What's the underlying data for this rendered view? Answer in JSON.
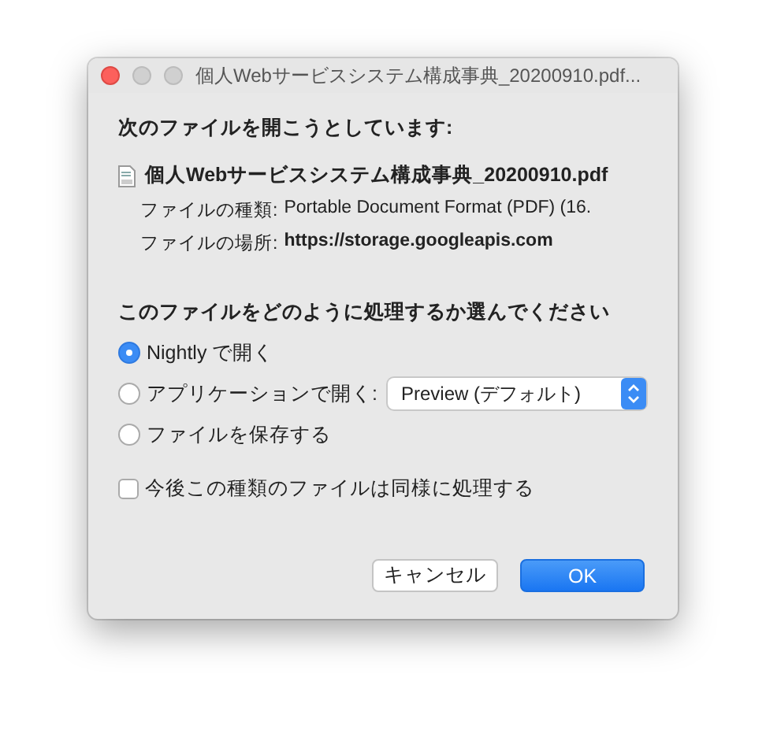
{
  "window": {
    "title": "個人Webサービスシステム構成事典_20200910.pdf..."
  },
  "heading": "次のファイルを開こうとしています:",
  "file": {
    "name": "個人Webサービスシステム構成事典_20200910.pdf",
    "details": [
      {
        "label": "ファイルの種類:",
        "value": "Portable Document Format (PDF) (16.",
        "bold": false
      },
      {
        "label": "ファイルの場所:",
        "value": "https://storage.googleapis.com",
        "bold": true
      }
    ]
  },
  "question": "このファイルをどのように処理するか選んでください",
  "options": [
    {
      "kind": "plain",
      "label": "Nightly で開く",
      "selected": true
    },
    {
      "kind": "app",
      "label": "アプリケーションで開く:",
      "selected": false,
      "app": "Preview (デフォルト)"
    },
    {
      "kind": "plain",
      "label": "ファイルを保存する",
      "selected": false
    }
  ],
  "remember": {
    "label": "今後この種類のファイルは同様に処理する",
    "checked": false
  },
  "buttons": [
    {
      "label": "キャンセル",
      "kind": "secondary"
    },
    {
      "label": "OK",
      "kind": "primary"
    }
  ]
}
